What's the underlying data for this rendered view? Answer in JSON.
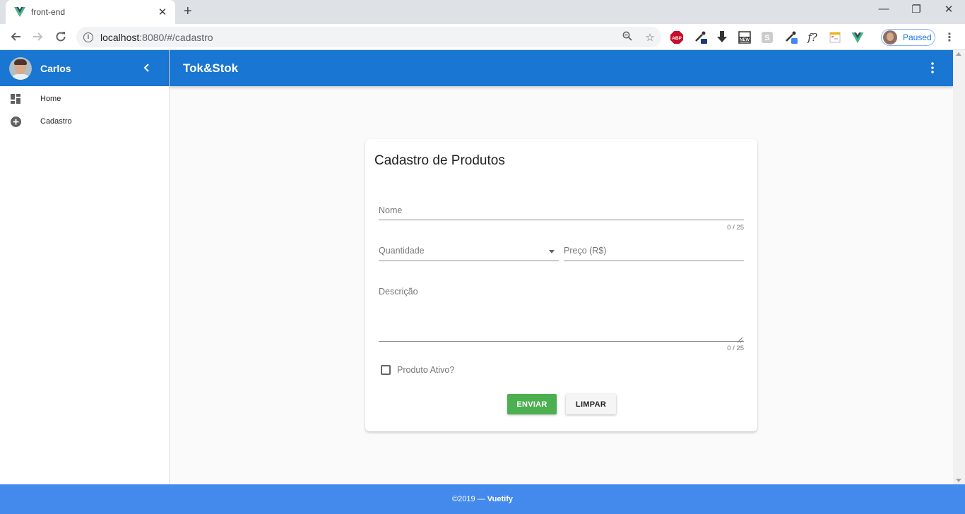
{
  "browser": {
    "tab_title": "front-end",
    "url_host": "localhost",
    "url_rest": ":8080/#/cadastro",
    "profile_status": "Paused",
    "extensions": [
      "abp-icon",
      "eyedropper-icon",
      "download-icon",
      "new-icon",
      "s-icon",
      "picker-icon",
      "fx-icon",
      "calendar-icon",
      "vue-icon"
    ]
  },
  "drawer": {
    "user_name": "Carlos",
    "items": [
      {
        "label": "Home",
        "icon": "dashboard-icon"
      },
      {
        "label": "Cadastro",
        "icon": "add-circle-icon"
      }
    ]
  },
  "appbar": {
    "title": "Tok&Stok"
  },
  "form": {
    "title": "Cadastro de Produtos",
    "nome_label": "Nome",
    "nome_counter": "0 / 25",
    "quantidade_label": "Quantidade",
    "preco_label": "Preço (R$)",
    "descricao_label": "Descrição",
    "descricao_counter": "0 / 25",
    "ativo_label": "Produto Ativo?",
    "send_label": "ENVIAR",
    "clear_label": "LIMPAR"
  },
  "footer": {
    "year": "©2019 —",
    "brand": "Vuetify"
  },
  "colors": {
    "primary": "#1976d2",
    "success": "#4caf50",
    "footer": "#448aed"
  }
}
